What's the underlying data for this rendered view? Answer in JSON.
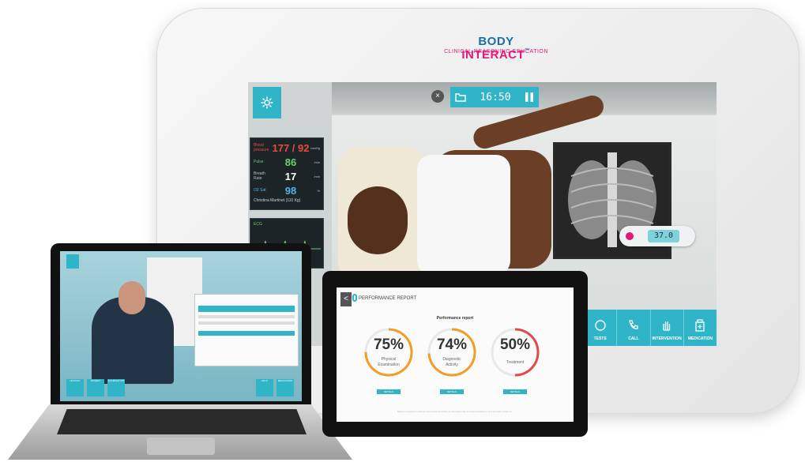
{
  "brand": {
    "name_part1": "BODY ",
    "name_part2": "INTERACT",
    "tm": "™",
    "tagline": "CLINICAL REASONING EDUCATION"
  },
  "sim": {
    "timer": "16:50",
    "close_glyph": "×",
    "vitals": {
      "bp_label": "Blood pressure",
      "bp_value": "177 / 92",
      "bp_unit": "mmHg",
      "pulse_label": "Pulse",
      "pulse_value": "86",
      "pulse_unit": "/min",
      "resp_label": "Breath Rate",
      "resp_value": "17",
      "resp_unit": "/min",
      "spo2_label": "O2 Sat",
      "spo2_value": "98",
      "spo2_unit": "%",
      "patient": "Christina Martinet (110 Kg)"
    },
    "ecg_label": "ECG",
    "thermometer": "37.0",
    "tabs": [
      {
        "label": "TESTS",
        "icon": "test-icon"
      },
      {
        "label": "CALL",
        "icon": "phone-icon"
      },
      {
        "label": "INTERVENTION",
        "icon": "hand-icon"
      },
      {
        "label": "MEDICATION",
        "icon": "medication-icon"
      }
    ]
  },
  "laptop": {
    "buttons": [
      {
        "label": "HISTORY"
      },
      {
        "label": "PATIENT"
      },
      {
        "label": "EXAMINATION"
      },
      {
        "label": "HELP"
      },
      {
        "label": "MEDICATION"
      }
    ]
  },
  "report": {
    "title": "PERFORMANCE REPORT",
    "back_glyph": "<",
    "subtitle": "Performance report",
    "scores": [
      {
        "pct": "75%",
        "label1": "Physical",
        "label2": "Examination",
        "value": 75,
        "color": "#f39c26"
      },
      {
        "pct": "74%",
        "label1": "Diagnostic",
        "label2": "Activity",
        "value": 74,
        "color": "#f39c26"
      },
      {
        "pct": "50%",
        "label1": "Treatment",
        "label2": "",
        "value": 50,
        "color": "#e04a4a"
      }
    ],
    "details_label": "DETAILS",
    "footer": "Based on patient's data as advocated according to internationally accepted guidelines and scientific evidence."
  }
}
